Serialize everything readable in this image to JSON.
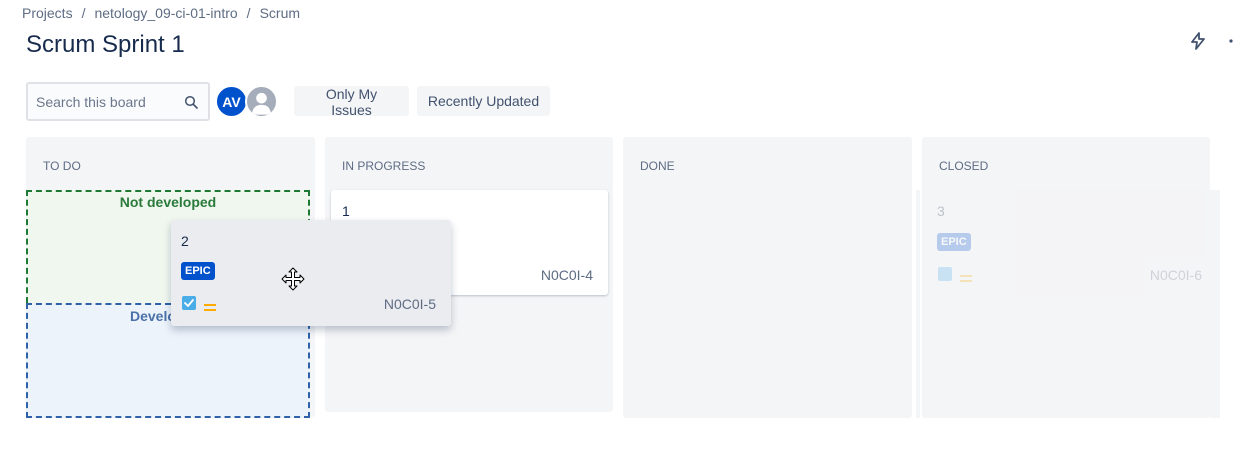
{
  "breadcrumb": {
    "items": [
      "Projects",
      "netology_09-ci-01-intro",
      "Scrum"
    ],
    "separator": "/"
  },
  "page": {
    "title": "Scrum Sprint 1"
  },
  "toolbar": {
    "search_placeholder": "Search this board",
    "avatar_initials": "AV",
    "filters": [
      "Only My Issues",
      "Recently Updated"
    ]
  },
  "columns": [
    {
      "title": "TO DO"
    },
    {
      "title": "IN PROGRESS"
    },
    {
      "title": "DONE"
    },
    {
      "title": "CLOSED"
    }
  ],
  "swimlanes": {
    "not_developed": "Not developed",
    "developed": "Develo"
  },
  "cards": {
    "in_progress": {
      "number": "1",
      "key": "N0C0I-4"
    },
    "dragging": {
      "number": "2",
      "badge": "EPIC",
      "key": "N0C0I-5"
    },
    "closed_ghost": {
      "number": "3",
      "badge": "EPIC",
      "key": "N0C0I-6"
    }
  },
  "colors": {
    "brand_blue": "#0052cc",
    "zone_green": "#1e7a32",
    "zone_blue": "#2e61a8",
    "column_bg": "#f4f5f7",
    "priority_medium": "#ffab00",
    "check_blue": "#4bade8"
  },
  "icons": {
    "header_action": "lightning-icon",
    "search": "search-icon",
    "issue_type": "task-checkbox-icon",
    "priority": "priority-medium-icon",
    "cursor": "move-cursor-icon"
  }
}
